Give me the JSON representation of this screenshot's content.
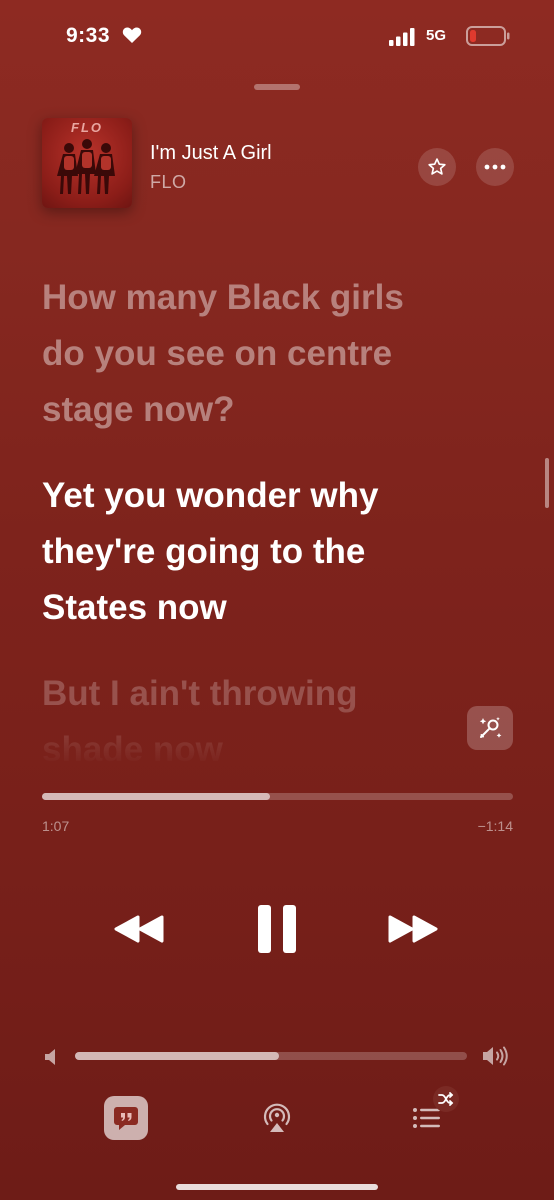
{
  "status_bar": {
    "time": "9:33",
    "network": "5G",
    "heart_icon": "heart-icon",
    "signal_icon": "cellular-signal-icon",
    "battery_icon": "battery-low-icon",
    "battery_color": "#e03a2e"
  },
  "now_playing": {
    "title": "I'm Just A Girl",
    "artist": "FLO",
    "album_art_text": "FLO"
  },
  "lyrics": [
    {
      "line1": "How many Black girls",
      "line2": "do you see on centre",
      "line3": "stage now?"
    },
    {
      "line1": "Yet you wonder why",
      "line2": "they're going to the",
      "line3": "States now"
    },
    {
      "line1": "But I ain't throwing",
      "line2": "shade now"
    }
  ],
  "playback": {
    "elapsed": "1:07",
    "remaining": "−1:14",
    "progress": 0.485,
    "state": "playing"
  },
  "volume": {
    "level": 0.52
  },
  "colors": {
    "background_top": "#8e2a22",
    "background_bottom": "#6e1c17",
    "accent": "#ffffff"
  },
  "icons": {
    "favorite": "star-icon",
    "more": "ellipsis-icon",
    "sing": "microphone-sparkle-icon",
    "rewind": "rewind-icon",
    "pause": "pause-icon",
    "forward": "fast-forward-icon",
    "lyrics": "quote-bubble-icon",
    "airplay": "airplay-audio-icon",
    "queue": "queue-list-icon",
    "shuffle": "shuffle-icon"
  }
}
